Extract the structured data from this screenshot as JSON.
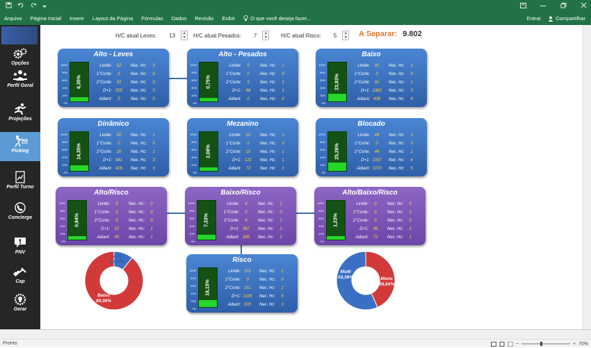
{
  "titlebar": {
    "qa_icons": [
      "save-icon",
      "undo-icon",
      "redo-icon",
      "customize-icon"
    ]
  },
  "ribbon": {
    "tabs": [
      "Arquivo",
      "Página Inicial",
      "Inserir",
      "Layout da Página",
      "Fórmulas",
      "Dados",
      "Revisão",
      "Exibir"
    ],
    "tell_me": "O que você deseja fazer...",
    "signin": "Entrar",
    "share": "Compartilhar"
  },
  "sidebar": {
    "items": [
      {
        "label": "Opções",
        "icon": "gears-icon"
      },
      {
        "label": "Perfil Geral",
        "icon": "people-icon"
      },
      {
        "label": "Projeções",
        "icon": "runner-icon"
      },
      {
        "label": "Picking",
        "icon": "picker-icon"
      },
      {
        "label": "Perfil Turno",
        "icon": "chart-doc-icon"
      },
      {
        "label": "Concierge",
        "icon": "phone-icon"
      },
      {
        "label": "PNV",
        "icon": "alert-icon"
      },
      {
        "label": "Cap",
        "icon": "dumbbell-icon"
      },
      {
        "label": "Gerar",
        "icon": "gear-bulb-icon"
      }
    ]
  },
  "header": {
    "leves_label": "H/C atual Leves:",
    "leves_value": "13",
    "pesados_label": "H/C atual Pesados:",
    "pesados_value": "7",
    "risco_label": "H/C atual Risco:",
    "risco_value": "5",
    "separar_label": "A Separar:",
    "separar_value": "9.802"
  },
  "row_labels": [
    "Limite:",
    "1°Corte:",
    "2°Corte:",
    "D+1:",
    "Adiant:"
  ],
  "nec_label": "Nec. Hc:",
  "axis_ticks": [
    "100%",
    "80%",
    "60%",
    "40%",
    "20%",
    "0%"
  ],
  "cards": [
    {
      "title": "Alto - Leves",
      "pct_label": "6,35%",
      "pct": 0.0635,
      "color": "blue",
      "values": [
        "52",
        "0",
        "52",
        "555",
        "0"
      ],
      "nec": [
        "3",
        "0",
        "3",
        "3",
        "0"
      ]
    },
    {
      "title": "Alto - Pesados",
      "pct_label": "0,75%",
      "pct": 0.0075,
      "color": "blue",
      "values": [
        "5",
        "0",
        "5",
        "68",
        "0"
      ],
      "nec": [
        "1",
        "0",
        "1",
        "1",
        "0"
      ]
    },
    {
      "title": "Baixo",
      "pct_label": "23,93%",
      "pct": 0.2393,
      "color": "blue",
      "values": [
        "91",
        "0",
        "91",
        "1383",
        "406"
      ],
      "nec": [
        "1",
        "0",
        "1",
        "3",
        "4"
      ]
    },
    {
      "title": "Dinâmico",
      "pct_label": "14,35%",
      "pct": 0.1435,
      "color": "blue",
      "values": [
        "20",
        "0",
        "20",
        "441",
        "426"
      ],
      "nec": [
        "1",
        "0",
        "1",
        "3",
        "3"
      ]
    },
    {
      "title": "Mezanino",
      "pct_label": "2,08%",
      "pct": 0.0208,
      "color": "blue",
      "values": [
        "10",
        "0",
        "10",
        "121",
        "72"
      ],
      "nec": [
        "1",
        "0",
        "1",
        "1",
        "1"
      ]
    },
    {
      "title": "Blocado",
      "pct_label": "25,26%",
      "pct": 0.2526,
      "color": "blue",
      "values": [
        "44",
        "0",
        "44",
        "1357",
        "1070"
      ],
      "nec": [
        "1",
        "0",
        "1",
        "4",
        "5"
      ]
    },
    {
      "title": "Alto/Risco",
      "pct_label": "0,94%",
      "pct": 0.0094,
      "color": "purple",
      "values": [
        "0",
        "0",
        "0",
        "52",
        "40"
      ],
      "nec": [
        "0",
        "0",
        "0",
        "1",
        "1"
      ]
    },
    {
      "title": "Baixo/Risco",
      "pct_label": "7,33%",
      "pct": 0.0733,
      "color": "purple",
      "values": [
        "6",
        "0",
        "6",
        "367",
        "345"
      ],
      "nec": [
        "1",
        "0",
        "1",
        "2",
        "2"
      ]
    },
    {
      "title": "Alto/Baixo/Risco",
      "pct_label": "1,23%",
      "pct": 0.0123,
      "color": "purple",
      "values": [
        "0",
        "0",
        "0",
        "49",
        "72"
      ],
      "nec": [
        "0",
        "0",
        "0",
        "1",
        "1"
      ]
    },
    {
      "title": "Risco",
      "pct_label": "18,15%",
      "pct": 0.1815,
      "color": "blue",
      "values": [
        "151",
        "0",
        "151",
        "1105",
        "533"
      ],
      "nec": [
        "1",
        "0",
        "1",
        "5",
        "3"
      ]
    }
  ],
  "chart_data": [
    {
      "type": "pie",
      "categories": [
        "Alto",
        "Baixo"
      ],
      "values": [
        10.64,
        89.36
      ],
      "labels": [
        "Alto\n10,64%",
        "Baixo\n89,36%"
      ],
      "colors": [
        "#3a6fc4",
        "#d23a3a"
      ],
      "donut": true
    },
    {
      "type": "pie",
      "categories": [
        "Multi",
        "Mono"
      ],
      "values": [
        43.36,
        56.64
      ],
      "labels": [
        "Multi\n43,36%",
        "Mono\n56,64%"
      ],
      "colors": [
        "#d23a3a",
        "#3a6fc4"
      ],
      "donut": true
    }
  ],
  "status": {
    "ready": "Pronto",
    "zoom": "70%"
  }
}
